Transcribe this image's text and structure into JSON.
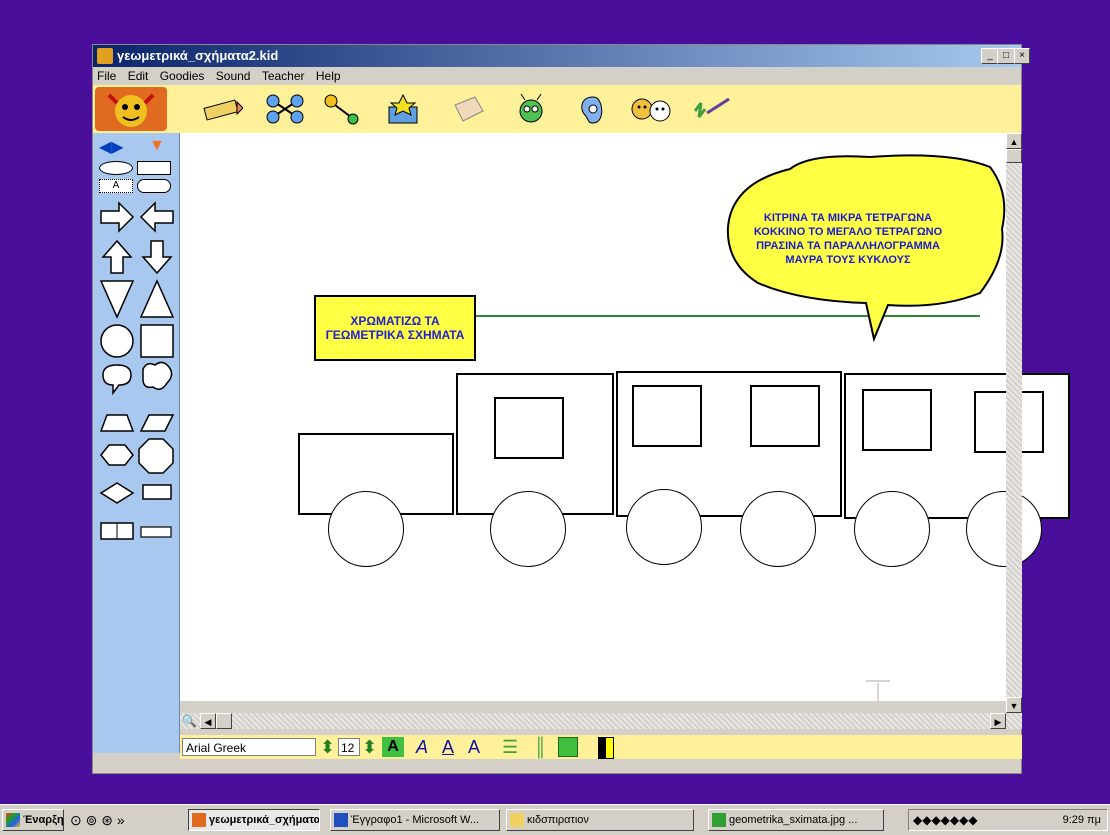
{
  "window": {
    "title": "γεωμετρικά_σχήματα2.kid",
    "min": "_",
    "max": "□",
    "close": "×"
  },
  "menu": [
    "File",
    "Edit",
    "Goodies",
    "Sound",
    "Teacher",
    "Help"
  ],
  "canvas": {
    "label_box": {
      "line1": "ΧΡΩΜΑΤΙΖΩ ΤΑ",
      "line2": "ΓΕΩΜΕΤΡΙΚΑ ΣΧΗΜΑΤΑ"
    },
    "bubble": {
      "lines": [
        "ΚΙΤΡΙΝΑ ΤΑ ΜΙΚΡΑ ΤΕΤΡΑΓΩΝΑ",
        "ΚΟΚΚΙΝΟ ΤΟ ΜΕΓΑΛΟ ΤΕΤΡΑΓΩΝΟ",
        "ΠΡΑΣΙΝΑ ΤΑ ΠΑΡΑΛΛΗΛΟΓΡΑΜΜΑ",
        "ΜΑΥΡΑ ΤΟΥΣ ΚΥΚΛΟΥΣ"
      ]
    }
  },
  "statusbar": {
    "font": "Arial Greek",
    "size": "12"
  },
  "taskbar": {
    "start": "Έναρξη",
    "tasks": [
      "γεωμετρικά_σχήματα...",
      "Έγγραφο1 - Microsoft W...",
      "κιδσπιρατιον",
      "geometrika_sximata.jpg ..."
    ],
    "clock": "9:29 πμ"
  },
  "colors": {
    "desktop": "#4a0f9a",
    "toolbar": "#fff09a",
    "palette": "#a8c8f0",
    "label_fill": "#ffff44",
    "text_blue": "#2020d0"
  }
}
